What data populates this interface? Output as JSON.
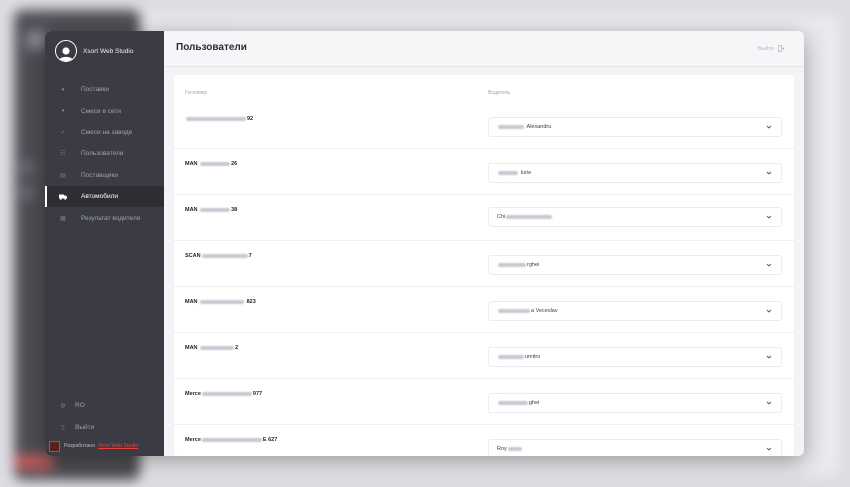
{
  "window": {
    "profile_name": "Xsort Web Studio",
    "title": "Пользователи",
    "logout_label": "Выйти"
  },
  "sidebar": {
    "items": [
      {
        "label": "Поставки",
        "icon": "circle-icon"
      },
      {
        "label": "Смеси в сети",
        "icon": "circle-icon"
      },
      {
        "label": "Смеси на заводе",
        "icon": "check-icon"
      },
      {
        "label": "Пользователи",
        "icon": "users-icon"
      },
      {
        "label": "Поставщики",
        "icon": "list-icon"
      },
      {
        "label": "Автомобили",
        "icon": "truck-icon",
        "active": true
      },
      {
        "label": "Результат водителя",
        "icon": "grid-icon"
      }
    ],
    "language": "RO",
    "exit": "Выйти",
    "developer_prefix": "Разработано",
    "developer_link": "Xsort Web Studio"
  },
  "table": {
    "col_plate": "Госномер",
    "col_driver": "Водитель",
    "rows": [
      {
        "plate_prefix": "",
        "plate_suffix": "92",
        "driver_suffix": "Alexandru"
      },
      {
        "plate_prefix": "MAN",
        "plate_suffix": "26",
        "driver_suffix": "Iurie"
      },
      {
        "plate_prefix": "MAN",
        "plate_suffix": "38",
        "driver_suffix": "Chi"
      },
      {
        "plate_prefix": "SCAN",
        "plate_suffix": "7",
        "driver_suffix": "rghei"
      },
      {
        "plate_prefix": "MAN",
        "plate_suffix": "823",
        "driver_suffix": "a Veceslav"
      },
      {
        "plate_prefix": "MAN",
        "plate_suffix": "2",
        "driver_suffix": "umitru"
      },
      {
        "plate_prefix": "Merce",
        "plate_suffix": "977",
        "driver_suffix": "ghei"
      },
      {
        "plate_prefix": "Merce",
        "plate_suffix": "E 627",
        "driver_suffix": "Roy"
      }
    ]
  },
  "colors": {
    "sidebar_bg": "#3a3b43",
    "active_bg": "#2d2e34",
    "accent_red": "#e0443a"
  }
}
